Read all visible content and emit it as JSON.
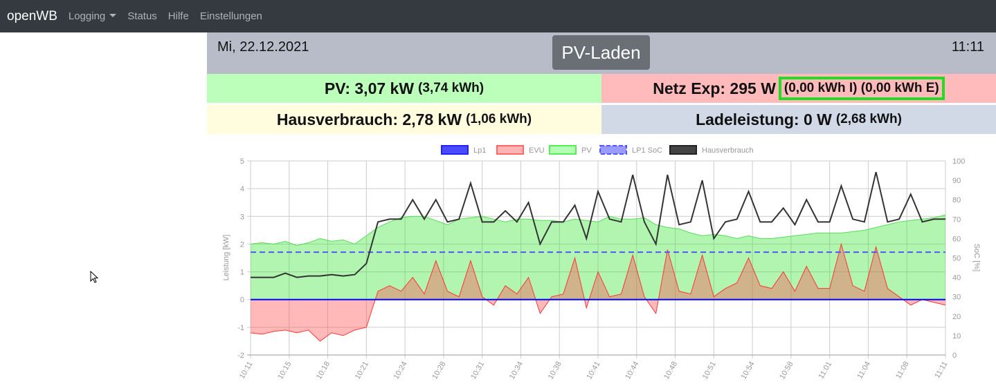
{
  "nav": {
    "brand": "openWB",
    "items": [
      "Logging",
      "Status",
      "Hilfe",
      "Einstellungen"
    ]
  },
  "header": {
    "date": "Mi, 22.12.2021",
    "time": "11:11",
    "mode": "PV-Laden"
  },
  "tiles": {
    "pv": {
      "label": "PV: 3,07 kW",
      "sub": "(3,74 kWh)",
      "color": "#bbffbb"
    },
    "netz": {
      "label": "Netz Exp: 295 W",
      "sub": "(0,00 kWh I) (0,00 kWh E)",
      "color": "#ffbbbb"
    },
    "haus": {
      "label": "Hausverbrauch: 2,78 kW",
      "sub": "(1,06 kWh)",
      "color": "#fffdde"
    },
    "lade": {
      "label": "Ladeleistung: 0 W",
      "sub": "(2,68 kWh)",
      "color": "#d2d9e6"
    }
  },
  "chart_data": {
    "type": "line",
    "legend": [
      "Lp1",
      "EVU",
      "PV",
      "LP1 SoC",
      "Hausverbrauch"
    ],
    "legend_position": "top",
    "ylabel": "Leistung [kW]",
    "y2label": "SoC [%]",
    "ylim": [
      -2,
      5
    ],
    "y2lim": [
      0,
      100
    ],
    "yticks": [
      "5",
      "4",
      "3",
      "2",
      "1",
      "0",
      "-1",
      "-2"
    ],
    "y2ticks": [
      "100",
      "90",
      "80",
      "70",
      "60",
      "50",
      "40",
      "30",
      "20",
      "10",
      "0"
    ],
    "xticks": [
      "10:11",
      "10:15",
      "10:18",
      "10:21",
      "10:24",
      "10:28",
      "10:31",
      "10:34",
      "10:38",
      "10:41",
      "10:44",
      "10:48",
      "10:51",
      "10:54",
      "10:58",
      "11:01",
      "11:04",
      "11:08",
      "11:11"
    ],
    "colors": {
      "lp1": "#0000ff",
      "evu": "#ff3333",
      "pv": "#33dd33",
      "soc": "#5555ff",
      "haus": "#333333"
    },
    "soc": 53,
    "lp1": [
      0,
      0,
      0,
      0,
      0,
      0,
      0,
      0,
      0,
      0,
      0,
      0,
      0,
      0,
      0,
      0,
      0,
      0,
      0,
      0,
      0,
      0,
      0,
      0,
      0,
      0,
      0,
      0,
      0,
      0,
      0,
      0,
      0,
      0,
      0,
      0,
      0,
      0,
      0,
      0,
      0,
      0,
      0,
      0,
      0,
      0,
      0,
      0,
      0,
      0,
      0,
      0,
      0,
      0,
      0,
      0,
      0,
      0,
      0,
      0,
      0
    ],
    "pv": [
      2.0,
      2.05,
      2.0,
      2.1,
      1.95,
      2.05,
      2.2,
      2.1,
      2.15,
      2.0,
      2.3,
      2.6,
      2.8,
      2.95,
      3.0,
      3.0,
      2.85,
      2.7,
      2.9,
      2.95,
      3.0,
      2.9,
      2.8,
      2.9,
      2.9,
      2.85,
      2.85,
      2.8,
      2.9,
      2.85,
      2.8,
      3.0,
      2.9,
      2.9,
      2.95,
      2.7,
      2.6,
      2.55,
      2.4,
      2.3,
      2.35,
      2.3,
      2.2,
      2.3,
      2.2,
      2.2,
      2.25,
      2.3,
      2.35,
      2.4,
      2.4,
      2.4,
      2.45,
      2.5,
      2.6,
      2.7,
      2.8,
      2.85,
      2.9,
      2.95,
      3.05
    ],
    "haus": [
      0.8,
      0.8,
      0.8,
      0.95,
      0.8,
      0.85,
      0.85,
      0.9,
      0.85,
      0.9,
      1.3,
      2.8,
      2.9,
      2.9,
      3.6,
      2.9,
      3.6,
      2.8,
      2.9,
      4.2,
      2.8,
      2.8,
      3.2,
      2.8,
      3.5,
      2.0,
      2.8,
      2.8,
      3.4,
      2.2,
      3.9,
      2.9,
      2.8,
      4.5,
      2.8,
      2.0,
      4.5,
      2.7,
      2.8,
      4.3,
      2.2,
      2.8,
      2.9,
      3.9,
      2.8,
      2.8,
      3.3,
      2.7,
      3.6,
      2.8,
      2.8,
      4.1,
      2.9,
      2.8,
      4.6,
      2.8,
      2.9,
      3.8,
      2.8,
      2.9,
      2.9
    ],
    "evu": [
      -1.2,
      -1.25,
      -1.15,
      -1.1,
      -1.2,
      -1.1,
      -1.5,
      -1.2,
      -1.3,
      -1.1,
      -1.0,
      0.3,
      0.5,
      0.3,
      0.8,
      0.2,
      1.4,
      0.3,
      0.1,
      1.4,
      0.1,
      -0.2,
      0.5,
      0.2,
      0.8,
      -0.5,
      0.1,
      0.2,
      1.5,
      -0.3,
      1.0,
      0.1,
      0.2,
      1.6,
      0.1,
      -0.5,
      1.8,
      0.3,
      0.2,
      1.6,
      0.1,
      0.4,
      0.6,
      1.5,
      0.5,
      0.4,
      1.0,
      0.3,
      1.2,
      0.4,
      0.4,
      2.0,
      0.5,
      0.3,
      1.9,
      0.4,
      0.1,
      -0.2,
      0.0,
      -0.1,
      -0.2
    ]
  }
}
